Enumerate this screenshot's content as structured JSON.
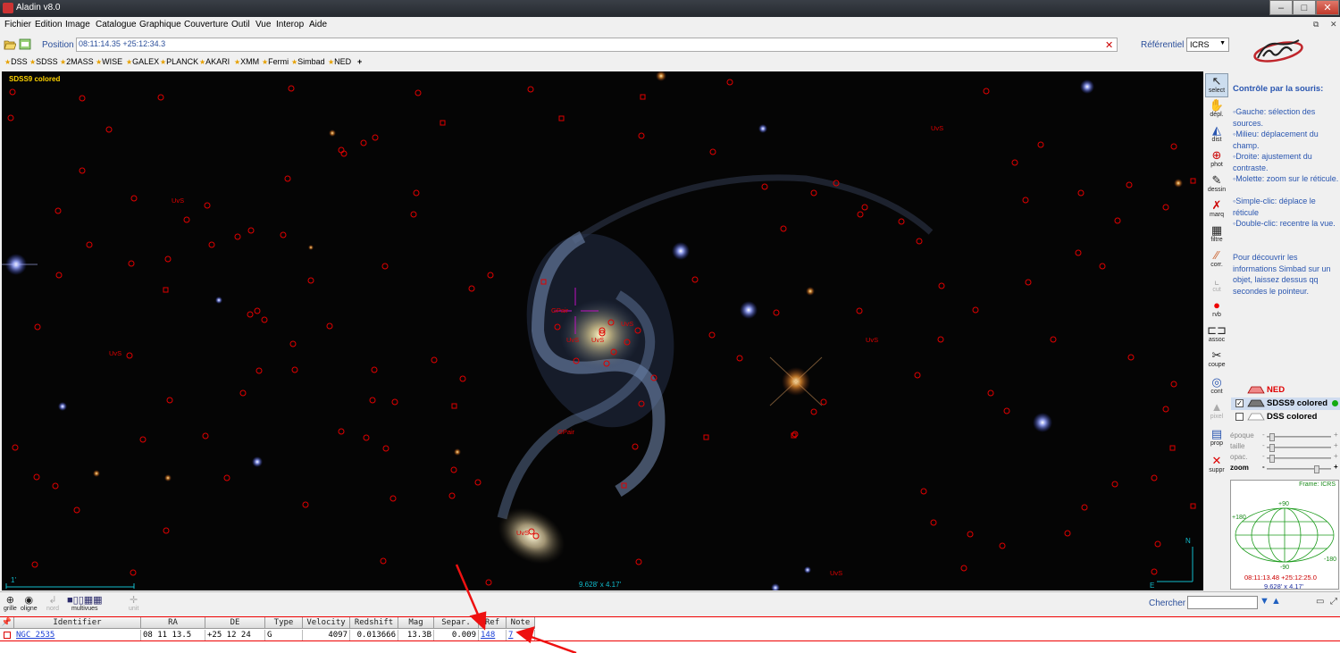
{
  "window": {
    "title": "Aladin v8.0"
  },
  "menu": [
    "Fichier",
    "Edition",
    "Image",
    "Catalogue",
    "Graphique",
    "Couverture",
    "Outil",
    "Vue",
    "Interop",
    "Aide"
  ],
  "position": {
    "label": "Position",
    "value": "08:11:14.35 +25:12:34.3"
  },
  "referentiel": {
    "label": "Référentiel",
    "value": "ICRS"
  },
  "surveys": [
    "DSS",
    "SDSS",
    "2MASS",
    "WISE",
    "GALEX",
    "PLANCK",
    "AKARI",
    "XMM",
    "Fermi",
    "Simbad",
    "NED"
  ],
  "surveys_add": "+",
  "view": {
    "survey": "SDSS9 colored",
    "fov": "9.628' x 4.17'",
    "scale": "1'",
    "labels": [
      "UvS",
      "UvS",
      "UvS",
      "UvS",
      "UvS",
      "UvS",
      "UvS",
      "UvS",
      "GPair",
      "GPair",
      "UvS"
    ],
    "compass_n": "N",
    "compass_e": "E"
  },
  "tools": [
    {
      "label": "select",
      "icon": "arrow-cursor-icon"
    },
    {
      "label": "dépl.",
      "icon": "hand-icon"
    },
    {
      "label": "dist",
      "icon": "distance-icon"
    },
    {
      "label": "phot",
      "icon": "photometry-icon"
    },
    {
      "label": "dessin",
      "icon": "pencil-icon"
    },
    {
      "label": "marq",
      "icon": "marker-icon"
    },
    {
      "label": "filtre",
      "icon": "filter-icon"
    },
    {
      "label": "corr.",
      "icon": "correction-icon"
    },
    {
      "label": "cut",
      "icon": "cut-icon"
    },
    {
      "label": "rvb",
      "icon": "rgb-icon"
    },
    {
      "label": "assoc",
      "icon": "assoc-icon"
    },
    {
      "label": "coupe",
      "icon": "scissors-icon"
    },
    {
      "label": "cont",
      "icon": "contour-icon"
    },
    {
      "label": "pixel",
      "icon": "pixel-icon"
    },
    {
      "label": "prop",
      "icon": "properties-icon"
    },
    {
      "label": "suppr",
      "icon": "delete-icon"
    }
  ],
  "help": {
    "title": "Contrôle par la souris:",
    "items": [
      "◦Gauche: sélection des sources.",
      "◦Milieu: déplacement du champ.",
      "◦Droite: ajustement du contraste.",
      "◦Molette: zoom sur le réticule.",
      "◦Simple-clic: déplace le réticule",
      "◦Double-clic: recentre la vue."
    ],
    "tip": "Pour découvrir les informations Simbad sur un objet, laissez dessus qq secondes le pointeur."
  },
  "layers": [
    {
      "name": "NED",
      "color": "#e00000",
      "checked": false
    },
    {
      "name": "SDSS9 colored",
      "color": "#000000",
      "checked": true
    },
    {
      "name": "DSS colored",
      "color": "#000000",
      "checked": false
    }
  ],
  "sliders": [
    {
      "name": "époque",
      "value": 0.05,
      "active": false
    },
    {
      "name": "taille",
      "value": 0.05,
      "active": false
    },
    {
      "name": "opac.",
      "value": 0.05,
      "active": false
    },
    {
      "name": "zoom",
      "value": 0.8,
      "active": true
    }
  ],
  "globe": {
    "frame": "Frame: ICRS",
    "lat_top": "+90",
    "lat_bottom": "-90",
    "lon_left": "+180",
    "lon_right": "-180",
    "coord": "08:11:13.48 +25:12:25.0",
    "fov": "9.628' x 4.17'"
  },
  "statusbar": {
    "buttons": [
      {
        "label": "grille",
        "icon": "grid-icon",
        "enabled": true
      },
      {
        "label": "oligne",
        "icon": "eye-icon",
        "enabled": true
      },
      {
        "label": "nord",
        "icon": "north-icon",
        "enabled": false
      },
      {
        "label": "multivues",
        "icon": "multiview-icon",
        "enabled": true
      },
      {
        "label": "unit",
        "icon": "unit-icon",
        "enabled": false
      }
    ],
    "find_label": "Chercher"
  },
  "table": {
    "columns": [
      "Identifier",
      "RA",
      "DE",
      "Type",
      "Velocity",
      "Redshift",
      "Mag",
      "Separ.",
      "Ref",
      "Note"
    ],
    "rows": [
      [
        "NGC 2535",
        "08 11 13.5",
        "+25 12 24",
        "G",
        "4097",
        "0.013666",
        "13.3B",
        "0.009",
        "148",
        "7"
      ]
    ]
  },
  "colors": {
    "accent": "#2a4e9a",
    "catalog": "#e00000",
    "link": "#1a3fd6"
  }
}
